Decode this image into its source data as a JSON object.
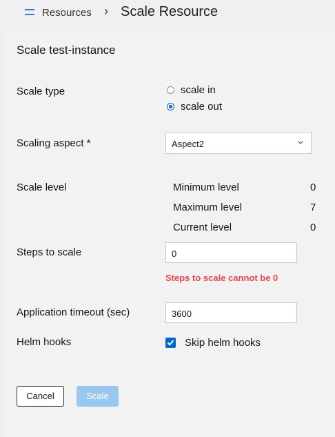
{
  "breadcrumb": {
    "parent": "Resources",
    "separator": "›",
    "current": "Scale Resource"
  },
  "dialog": {
    "title": "Scale test-instance"
  },
  "scale_type": {
    "label": "Scale type",
    "options": [
      "scale in",
      "scale out"
    ],
    "selected": "scale out"
  },
  "scaling_aspect": {
    "label": "Scaling aspect *",
    "value": "Aspect2"
  },
  "scale_level": {
    "label": "Scale level",
    "rows": [
      {
        "label": "Minimum level",
        "value": "0"
      },
      {
        "label": "Maximum level",
        "value": "7"
      },
      {
        "label": "Current level",
        "value": "0"
      }
    ]
  },
  "steps": {
    "label": "Steps to scale",
    "value": "0",
    "error": "Steps to scale cannot be 0"
  },
  "timeout": {
    "label": "Application timeout (sec)",
    "value": "3600"
  },
  "helm": {
    "label": "Helm hooks",
    "checkbox_label": "Skip helm hooks",
    "checked": true
  },
  "buttons": {
    "cancel": "Cancel",
    "scale": "Scale"
  },
  "colors": {
    "accent": "#0066cc",
    "error": "#e8474c",
    "disabled_button": "#99c7ed"
  }
}
